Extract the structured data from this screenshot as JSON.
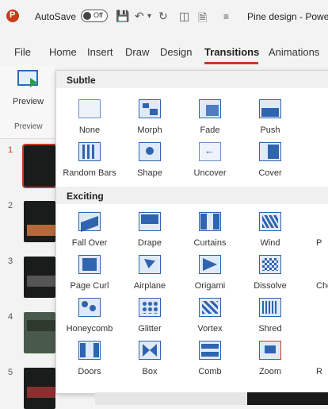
{
  "titlebar": {
    "autosave_label": "AutoSave",
    "autosave_state": "Off",
    "document_title": "Pine design - Powe"
  },
  "ribbon": {
    "tabs": [
      "File",
      "Home",
      "Insert",
      "Draw",
      "Design",
      "Transitions",
      "Animations"
    ],
    "active_tab": "Transitions",
    "preview_button_label": "Preview",
    "preview_group_label": "Preview",
    "accent_color": "#c43e1c"
  },
  "slides": {
    "numbers": [
      "1",
      "2",
      "3",
      "4",
      "5"
    ],
    "selected": "1"
  },
  "gallery": {
    "subtle_title": "Subtle",
    "exciting_title": "Exciting",
    "subtle_items": [
      "None",
      "Morph",
      "Fade",
      "Push",
      "Random Bars",
      "Shape",
      "Uncover",
      "Cover"
    ],
    "exciting_items": [
      "Fall Over",
      "Drape",
      "Curtains",
      "Wind",
      "Page Curl",
      "Airplane",
      "Origami",
      "Dissolve",
      "Honeycomb",
      "Glitter",
      "Vortex",
      "Shred",
      "Doors",
      "Box",
      "Comb",
      "Zoom"
    ],
    "clipped_items": [
      "P",
      "Che",
      "",
      "R"
    ]
  }
}
